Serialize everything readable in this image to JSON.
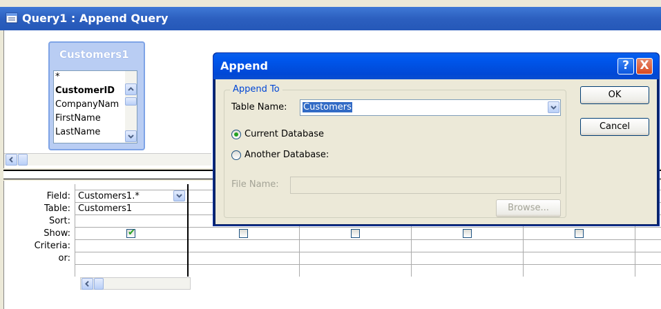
{
  "window": {
    "title": "Query1 : Append Query"
  },
  "table_window": {
    "name": "Customers1",
    "fields": [
      "*",
      "CustomerID",
      "CompanyNam",
      "FirstName",
      "LastName"
    ]
  },
  "grid": {
    "row_labels": {
      "field": "Field:",
      "table": "Table:",
      "sort": "Sort:",
      "show": "Show:",
      "criteria": "Criteria:",
      "or": "or:"
    },
    "column1": {
      "field": "Customers1.*",
      "table": "Customers1",
      "show": true
    },
    "other_columns_show": [
      false,
      false,
      false,
      false,
      false
    ]
  },
  "dialog": {
    "title": "Append",
    "help_label": "?",
    "close_label": "X",
    "group_label": "Append To",
    "table_name_label": "Table Name:",
    "table_name_value": "Customers",
    "radio_current": "Current Database",
    "radio_another": "Another Database:",
    "selected": "current",
    "file_name_label": "File Name:",
    "file_name_value": "",
    "ok_label": "OK",
    "cancel_label": "Cancel",
    "browse_label": "Browse..."
  }
}
